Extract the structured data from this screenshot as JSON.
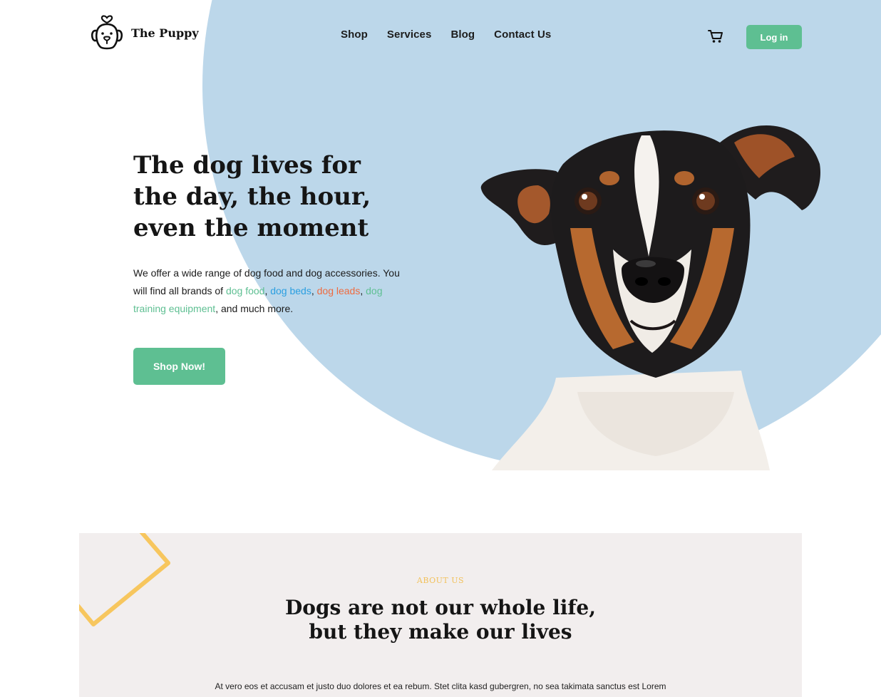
{
  "brand": {
    "name": "The Puppy",
    "logo_icon": "dog-heart-icon",
    "accent_green": "#5ebf92",
    "circle_blue": "#bcd7ea",
    "about_yellow": "#f2c15b"
  },
  "nav": {
    "items": [
      {
        "label": "Shop"
      },
      {
        "label": "Services"
      },
      {
        "label": "Blog"
      },
      {
        "label": "Contact Us"
      }
    ],
    "cart_icon": "cart-icon",
    "login_label": "Log in"
  },
  "hero": {
    "title": "The dog lives for the day, the hour, even the moment",
    "desc_intro": "We offer a wide range of dog food and dog accessories. You will find all brands of ",
    "links": [
      {
        "label": "dog food",
        "color": "#5ebf92"
      },
      {
        "label": "dog beds",
        "color": "#2b9fe0"
      },
      {
        "label": "dog leads",
        "color": "#ef6b3f"
      },
      {
        "label": "dog training equipment",
        "color": "#5ebf92"
      }
    ],
    "desc_sep": ", ",
    "desc_outro": ", and much more.",
    "cta_label": "Shop Now!"
  },
  "about": {
    "label": "ABOUT US",
    "title_line1": "Dogs are not our whole life,",
    "title_line2": "but they make our lives",
    "text": "At vero eos et accusam et justo duo dolores et ea rebum. Stet clita kasd gubergren, no sea takimata sanctus est Lorem"
  }
}
